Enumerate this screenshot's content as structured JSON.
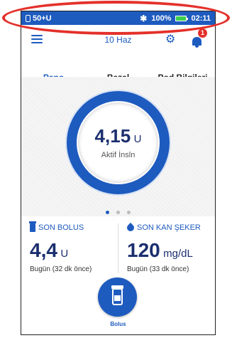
{
  "status_bar": {
    "left_text": "50+U",
    "bluetooth": "✱",
    "battery_percent": "100%",
    "time": "02:11"
  },
  "app_bar": {
    "title": "10 Haz",
    "notification_count": "1"
  },
  "tabs": [
    {
      "label": "Pano",
      "active": true
    },
    {
      "label": "Bazal",
      "active": false
    },
    {
      "label": "Pod Bilgileri",
      "active": false
    }
  ],
  "dashboard": {
    "active_insulin_value": "4,15",
    "active_insulin_unit": "U",
    "active_insulin_label": "Aktif İnsln",
    "page_indicator_total": 3,
    "page_indicator_active": 0
  },
  "last_bolus": {
    "heading": "SON BOLUS",
    "value": "4,4",
    "unit": "U",
    "subtext": "Bugün (32 dk önce)"
  },
  "last_bg": {
    "heading": "SON KAN ŞEKER",
    "value": "120",
    "unit": "mg/dL",
    "subtext": "Bugün (33 dk önce)"
  },
  "bolus_button": {
    "label": "Bolus"
  },
  "colors": {
    "accent": "#1e5bbf",
    "highlight_oval": "#e4302a",
    "badge": "#e4302a",
    "battery": "#3fce4f"
  },
  "icons": {
    "menu": "hamburger-menu-icon",
    "settings": "gear-icon",
    "notifications": "bell-icon",
    "bolus": "insulin-vial-icon",
    "blood_glucose": "drop-icon"
  }
}
